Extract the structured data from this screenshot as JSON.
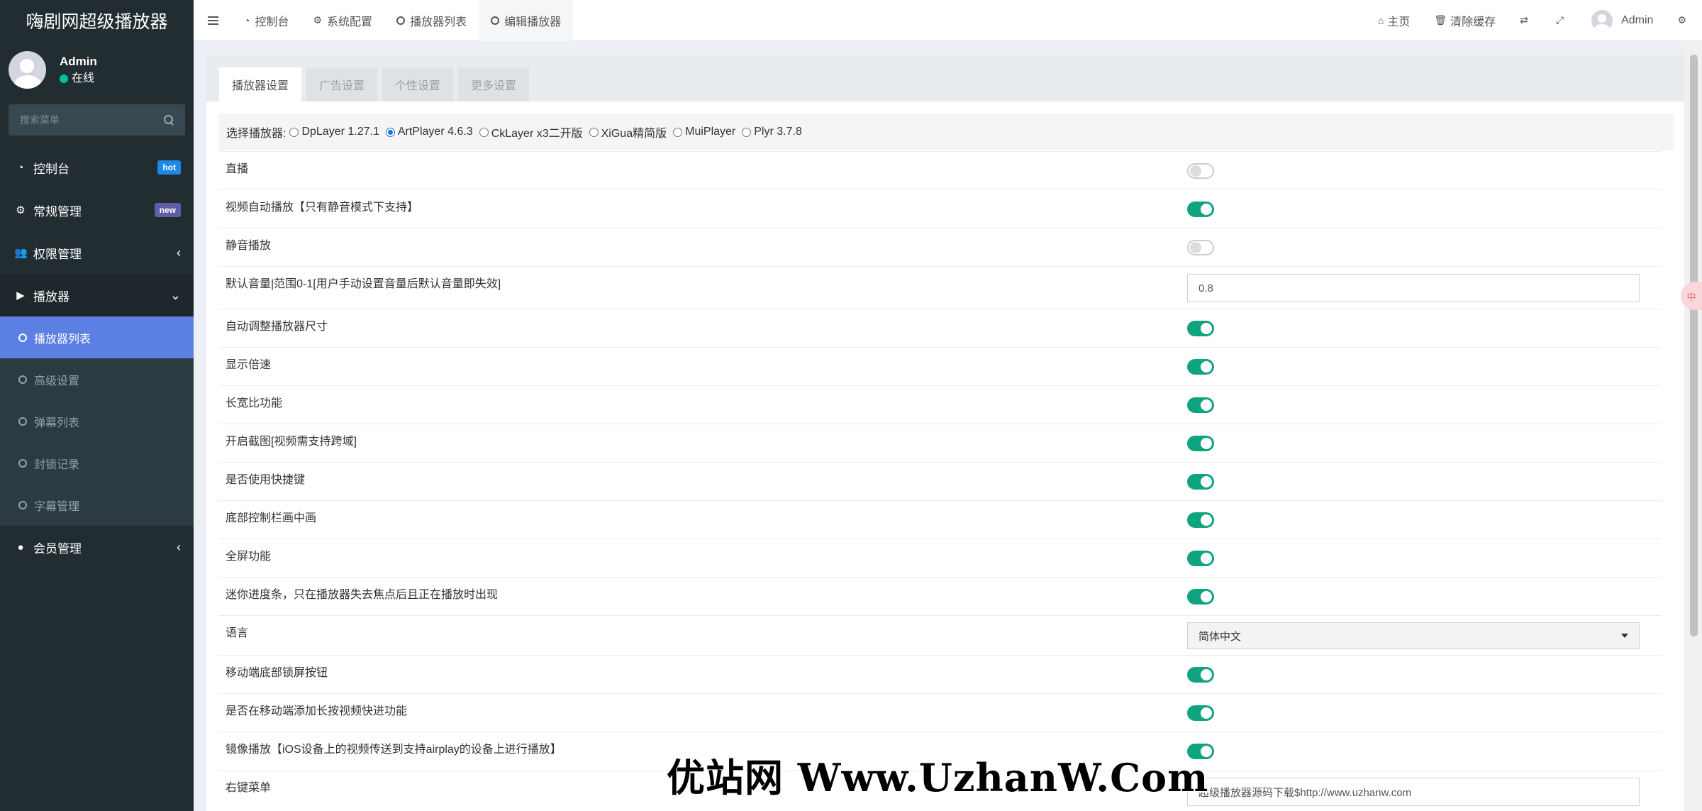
{
  "app": {
    "title": "嗨剧网超级播放器"
  },
  "user": {
    "name": "Admin",
    "status": "在线"
  },
  "sidebar": {
    "search_placeholder": "搜索菜单",
    "menu": [
      {
        "label": "控制台",
        "badge": "hot",
        "icon": "dashboard-icon"
      },
      {
        "label": "常规管理",
        "badge": "new",
        "icon": "cogs-icon"
      },
      {
        "label": "权限管理",
        "icon": "users-icon"
      },
      {
        "label": "播放器",
        "icon": "youtube-play-icon"
      },
      {
        "label": "会员管理",
        "icon": "user-circle-icon"
      }
    ],
    "submenu": [
      {
        "label": "播放器列表",
        "active": true
      },
      {
        "label": "高级设置"
      },
      {
        "label": "弹幕列表"
      },
      {
        "label": "封锁记录"
      },
      {
        "label": "字幕管理"
      }
    ]
  },
  "topbar": {
    "tabs": [
      {
        "label": "控制台",
        "icon": "dashboard-icon"
      },
      {
        "label": "系统配置",
        "icon": "gear-icon"
      },
      {
        "label": "播放器列表",
        "icon": "circle-icon"
      },
      {
        "label": "编辑播放器",
        "icon": "circle-icon",
        "active": true
      }
    ],
    "right": {
      "home": "主页",
      "clear_cache": "清除缓存",
      "user": "Admin"
    }
  },
  "panel": {
    "tabs": [
      "播放器设置",
      "广告设置",
      "个性设置",
      "更多设置"
    ],
    "player_select": {
      "label": "选择播放器:",
      "options": [
        "DpLayer 1.27.1",
        "ArtPlayer 4.6.3",
        "CkLayer x3二开版",
        "XiGua精简版",
        "MuiPlayer",
        "Plyr 3.7.8"
      ],
      "selected": "ArtPlayer 4.6.3"
    },
    "settings": [
      {
        "label": "直播",
        "type": "toggle",
        "value": false
      },
      {
        "label": "视频自动播放【只有静音模式下支持】",
        "type": "toggle",
        "value": true
      },
      {
        "label": "静音播放",
        "type": "toggle",
        "value": false
      },
      {
        "label": "默认音量|范围0-1[用户手动设置音量后默认音量即失效]",
        "type": "input",
        "value": "0.8"
      },
      {
        "label": "自动调整播放器尺寸",
        "type": "toggle",
        "value": true
      },
      {
        "label": "显示倍速",
        "type": "toggle",
        "value": true
      },
      {
        "label": "长宽比功能",
        "type": "toggle",
        "value": true
      },
      {
        "label": "开启截图[视频需支持跨域]",
        "type": "toggle",
        "value": true
      },
      {
        "label": "是否使用快捷键",
        "type": "toggle",
        "value": true
      },
      {
        "label": "底部控制栏画中画",
        "type": "toggle",
        "value": true
      },
      {
        "label": "全屏功能",
        "type": "toggle",
        "value": true
      },
      {
        "label": "迷你进度条，只在播放器失去焦点后且正在播放时出现",
        "type": "toggle",
        "value": true
      },
      {
        "label": "语言",
        "type": "select",
        "value": "简体中文"
      },
      {
        "label": "移动端底部锁屏按钮",
        "type": "toggle",
        "value": true
      },
      {
        "label": "是否在移动端添加长按视频快进功能",
        "type": "toggle",
        "value": true
      },
      {
        "label": "镜像播放【iOS设备上的视频传送到支持airplay的设备上进行播放】",
        "type": "toggle",
        "value": true
      },
      {
        "label": "右键菜单",
        "type": "input",
        "value": "超级播放器源码下载$http://www.uzhanw.com"
      }
    ]
  },
  "side_widget": "中",
  "watermark": "优站网 Www.UzhanW.Com",
  "colors": {
    "sidebar_bg": "#222d32",
    "active_sub": "#5b7fe3",
    "toggle_on": "#10a37f",
    "hot": "#1e88e5",
    "new": "#605ca8"
  }
}
